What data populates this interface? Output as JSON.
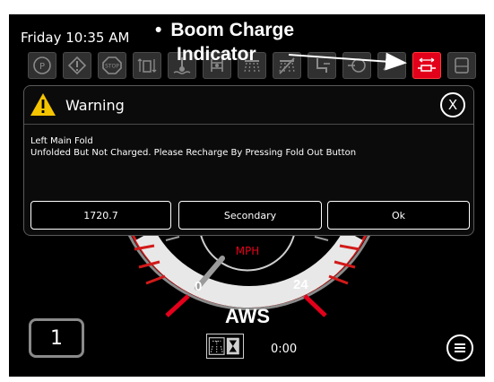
{
  "status_bar": {
    "datetime": "Friday 10:35 AM"
  },
  "annotation": {
    "bullet": "•",
    "line1": "Boom Charge",
    "line2": "Indicator"
  },
  "indicator_icons": [
    {
      "icon": "park-brake-icon",
      "active": false
    },
    {
      "icon": "warning-icon",
      "active": false
    },
    {
      "icon": "stop-icon",
      "active": false
    },
    {
      "icon": "boom-height-icon",
      "active": false
    },
    {
      "icon": "engine-temp-icon",
      "active": false
    },
    {
      "icon": "hydraulic-icon",
      "active": false
    },
    {
      "icon": "spray-icon",
      "active": false
    },
    {
      "icon": "no-spray-icon",
      "active": false
    },
    {
      "icon": "seat-icon",
      "active": false
    },
    {
      "icon": "transmission-icon",
      "active": false
    },
    {
      "icon": "fold-icon",
      "active": false
    },
    {
      "icon": "boom-charge-icon",
      "active": true
    },
    {
      "icon": "tank-icon",
      "active": false
    }
  ],
  "dialog": {
    "title": "Warning",
    "close_label": "X",
    "message_line1": "Left Main Fold",
    "message_line2": "Unfolded But Not Charged.  Please Recharge By Pressing Fold Out Button",
    "buttons": {
      "value": "1720.7",
      "secondary": "Secondary",
      "ok": "Ok"
    }
  },
  "gauge": {
    "unit": "MPH",
    "min_label": "0",
    "max_label": "24",
    "mode": "AWS",
    "speed": 0
  },
  "gear": "1",
  "timer": {
    "value": "0:00"
  },
  "colors": {
    "alert": "#e3001b",
    "warning": "#f5c400"
  }
}
